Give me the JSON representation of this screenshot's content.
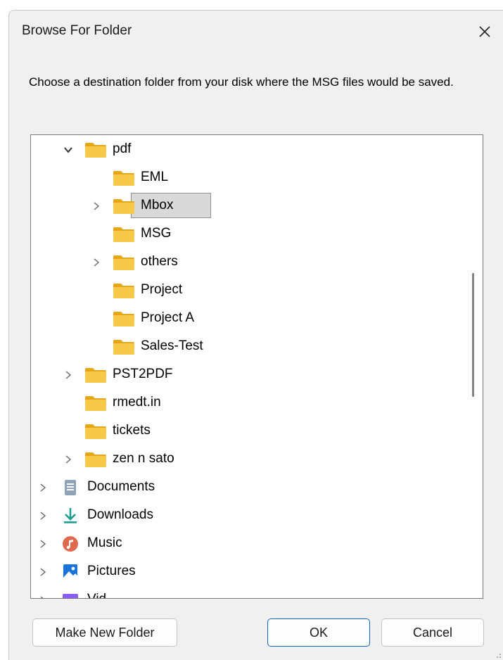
{
  "dialog": {
    "title": "Browse For Folder",
    "prompt": "Choose a destination folder from your disk where the MSG files would be saved."
  },
  "tree": {
    "items": [
      {
        "label": "pdf",
        "expander": "expanded",
        "icon": "folder-icon"
      },
      {
        "label": "EML",
        "expander": "none",
        "icon": "folder-icon"
      },
      {
        "label": "Mbox",
        "expander": "collapsed",
        "icon": "folder-icon",
        "selected": true
      },
      {
        "label": "MSG",
        "expander": "none",
        "icon": "folder-icon"
      },
      {
        "label": "others",
        "expander": "collapsed",
        "icon": "folder-icon"
      },
      {
        "label": "Project",
        "expander": "none",
        "icon": "folder-icon"
      },
      {
        "label": "Project A",
        "expander": "none",
        "icon": "folder-icon"
      },
      {
        "label": "Sales-Test",
        "expander": "none",
        "icon": "folder-icon"
      },
      {
        "label": "PST2PDF",
        "expander": "collapsed",
        "icon": "folder-icon"
      },
      {
        "label": "rmedt.in",
        "expander": "none",
        "icon": "folder-icon"
      },
      {
        "label": "tickets",
        "expander": "none",
        "icon": "folder-icon"
      },
      {
        "label": "zen n sato",
        "expander": "collapsed",
        "icon": "folder-icon"
      },
      {
        "label": "Documents",
        "expander": "collapsed",
        "icon": "documents-icon"
      },
      {
        "label": "Downloads",
        "expander": "collapsed",
        "icon": "downloads-icon"
      },
      {
        "label": "Music",
        "expander": "collapsed",
        "icon": "music-icon"
      },
      {
        "label": "Pictures",
        "expander": "collapsed",
        "icon": "pictures-icon"
      },
      {
        "label": "Vid",
        "expander": "collapsed",
        "icon": "videos-icon"
      }
    ]
  },
  "buttons": {
    "make_new_folder": "Make New Folder",
    "ok": "OK",
    "cancel": "Cancel"
  },
  "colors": {
    "folder": "#f7c948",
    "folder_dark": "#e6a817",
    "accent": "#0a66c2"
  }
}
